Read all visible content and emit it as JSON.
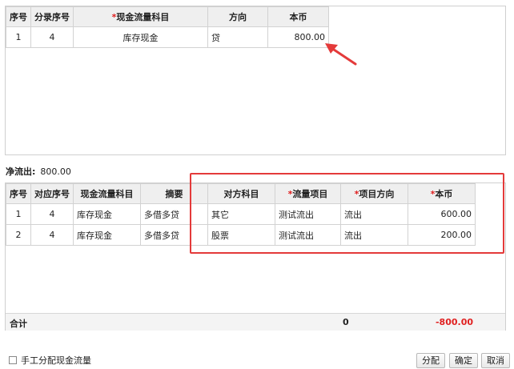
{
  "top_table": {
    "headers": [
      "序号",
      "分录序号",
      "现金流量科目",
      "方向",
      "本币"
    ],
    "rows": [
      {
        "seq": "1",
        "entry_seq": "4",
        "subject": "库存现金",
        "direction": "贷",
        "amount": "800.00"
      }
    ]
  },
  "net_outflow": {
    "label": "净流出:",
    "value": "800.00"
  },
  "bottom_table": {
    "headers": [
      "序号",
      "对应序号",
      "现金流量科目",
      "摘要",
      "对方科目",
      "流量项目",
      "项目方向",
      "本币"
    ],
    "rows": [
      {
        "seq": "1",
        "ref_seq": "4",
        "subject": "库存现金",
        "summary": "多借多贷",
        "counter_subject": "其它",
        "flow_item": "测试流出",
        "item_direction": "流出",
        "amount": "600.00"
      },
      {
        "seq": "2",
        "ref_seq": "4",
        "subject": "库存现金",
        "summary": "多借多贷",
        "counter_subject": "股票",
        "flow_item": "测试流出",
        "item_direction": "流出",
        "amount": "200.00"
      }
    ],
    "total": {
      "label": "合计",
      "zero": "0",
      "sum": "-800.00"
    }
  },
  "footer": {
    "manual_label": "手工分配现金流量",
    "distribute_button": "分配",
    "confirm_button": "确定",
    "cancel_button": "取消"
  },
  "colors": {
    "required_mark": "#e02020",
    "annotation_red": "#e43a3a",
    "total_sum": "#e02020"
  }
}
